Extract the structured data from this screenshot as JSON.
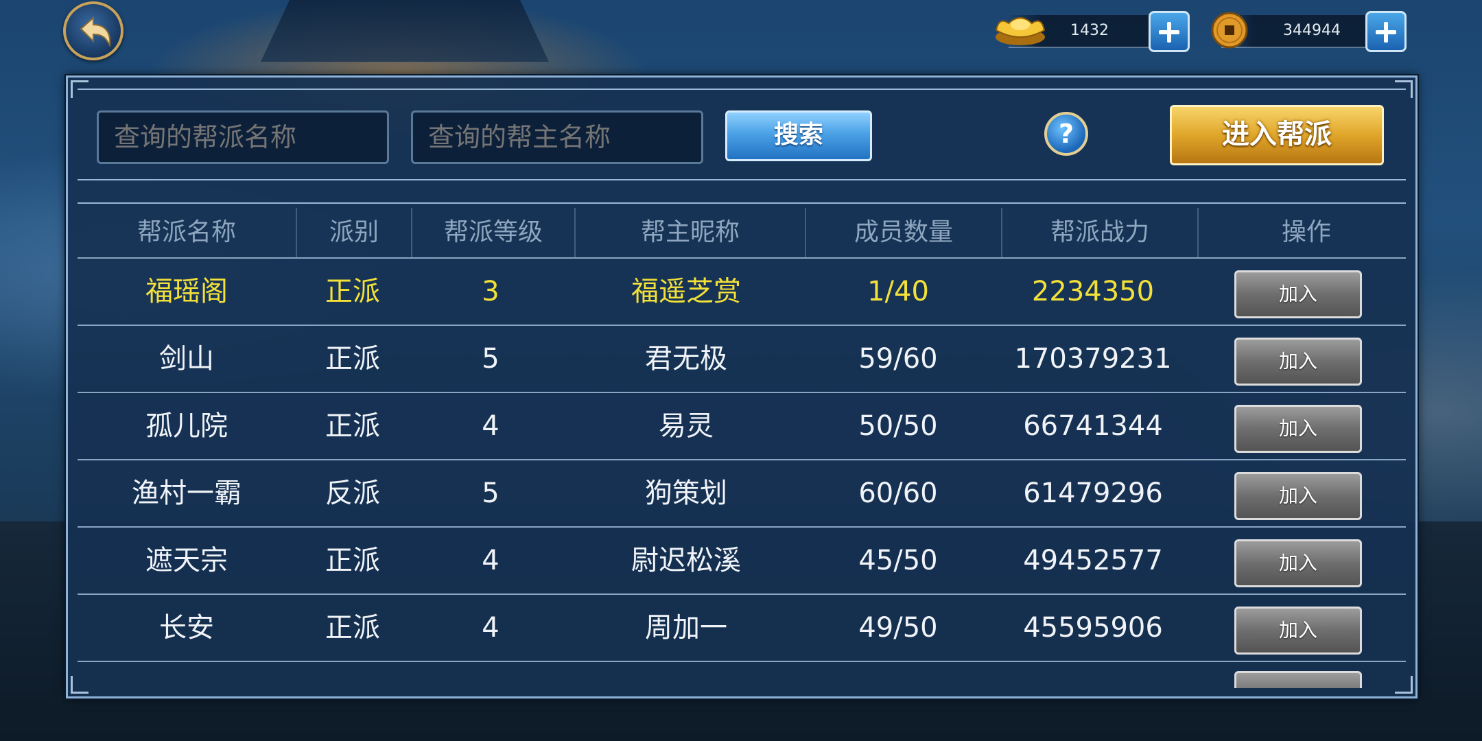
{
  "header": {
    "back_icon": "back-arrow-icon",
    "currencies": [
      {
        "icon": "gold-ingot-icon",
        "value": "1432"
      },
      {
        "icon": "copper-coin-icon",
        "value": "344944"
      }
    ]
  },
  "search": {
    "guild_name_placeholder": "查询的帮派名称",
    "leader_name_placeholder": "查询的帮主名称",
    "search_label": "搜索",
    "help_label": "?",
    "enter_guild_label": "进入帮派"
  },
  "table": {
    "columns": [
      "帮派名称",
      "派别",
      "帮派等级",
      "帮主昵称",
      "成员数量",
      "帮派战力",
      "操作"
    ],
    "rows": [
      {
        "name": "福瑶阁",
        "faction": "正派",
        "level": "3",
        "leader": "福遥芝赏",
        "members": "1/40",
        "power": "2234350",
        "action": "加入"
      },
      {
        "name": "剑山",
        "faction": "正派",
        "level": "5",
        "leader": "君无极",
        "members": "59/60",
        "power": "170379231",
        "action": "加入"
      },
      {
        "name": "孤儿院",
        "faction": "正派",
        "level": "4",
        "leader": "易灵",
        "members": "50/50",
        "power": "66741344",
        "action": "加入"
      },
      {
        "name": "渔村一霸",
        "faction": "反派",
        "level": "5",
        "leader": "狗策划",
        "members": "60/60",
        "power": "61479296",
        "action": "加入"
      },
      {
        "name": "遮天宗",
        "faction": "正派",
        "level": "4",
        "leader": "尉迟松溪",
        "members": "45/50",
        "power": "49452577",
        "action": "加入"
      },
      {
        "name": "长安",
        "faction": "正派",
        "level": "4",
        "leader": "周加一",
        "members": "49/50",
        "power": "45595906",
        "action": "加入"
      }
    ]
  },
  "colors": {
    "highlight_row": "#f3e13a",
    "normal_text": "#f0f4f8",
    "header_text": "#8ea6bf",
    "enter_button": "#e0a62a",
    "search_button": "#4ba2e6"
  }
}
